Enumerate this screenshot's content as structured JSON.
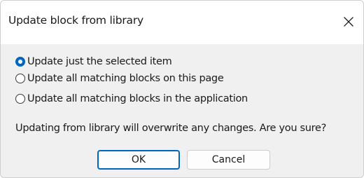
{
  "dialog": {
    "title": "Update block from library",
    "close_icon": "close-icon"
  },
  "options": [
    {
      "label": "Update just the selected item",
      "checked": true
    },
    {
      "label": "Update all matching blocks on this page",
      "checked": false
    },
    {
      "label": "Update all matching blocks in the application",
      "checked": false
    }
  ],
  "message": "Updating from library will overwrite any changes. Are you sure?",
  "buttons": {
    "ok_label": "OK",
    "cancel_label": "Cancel"
  },
  "colors": {
    "accent": "#0067c0",
    "titlebar_bg": "#ffffff",
    "body_bg": "#f0f0f0"
  }
}
